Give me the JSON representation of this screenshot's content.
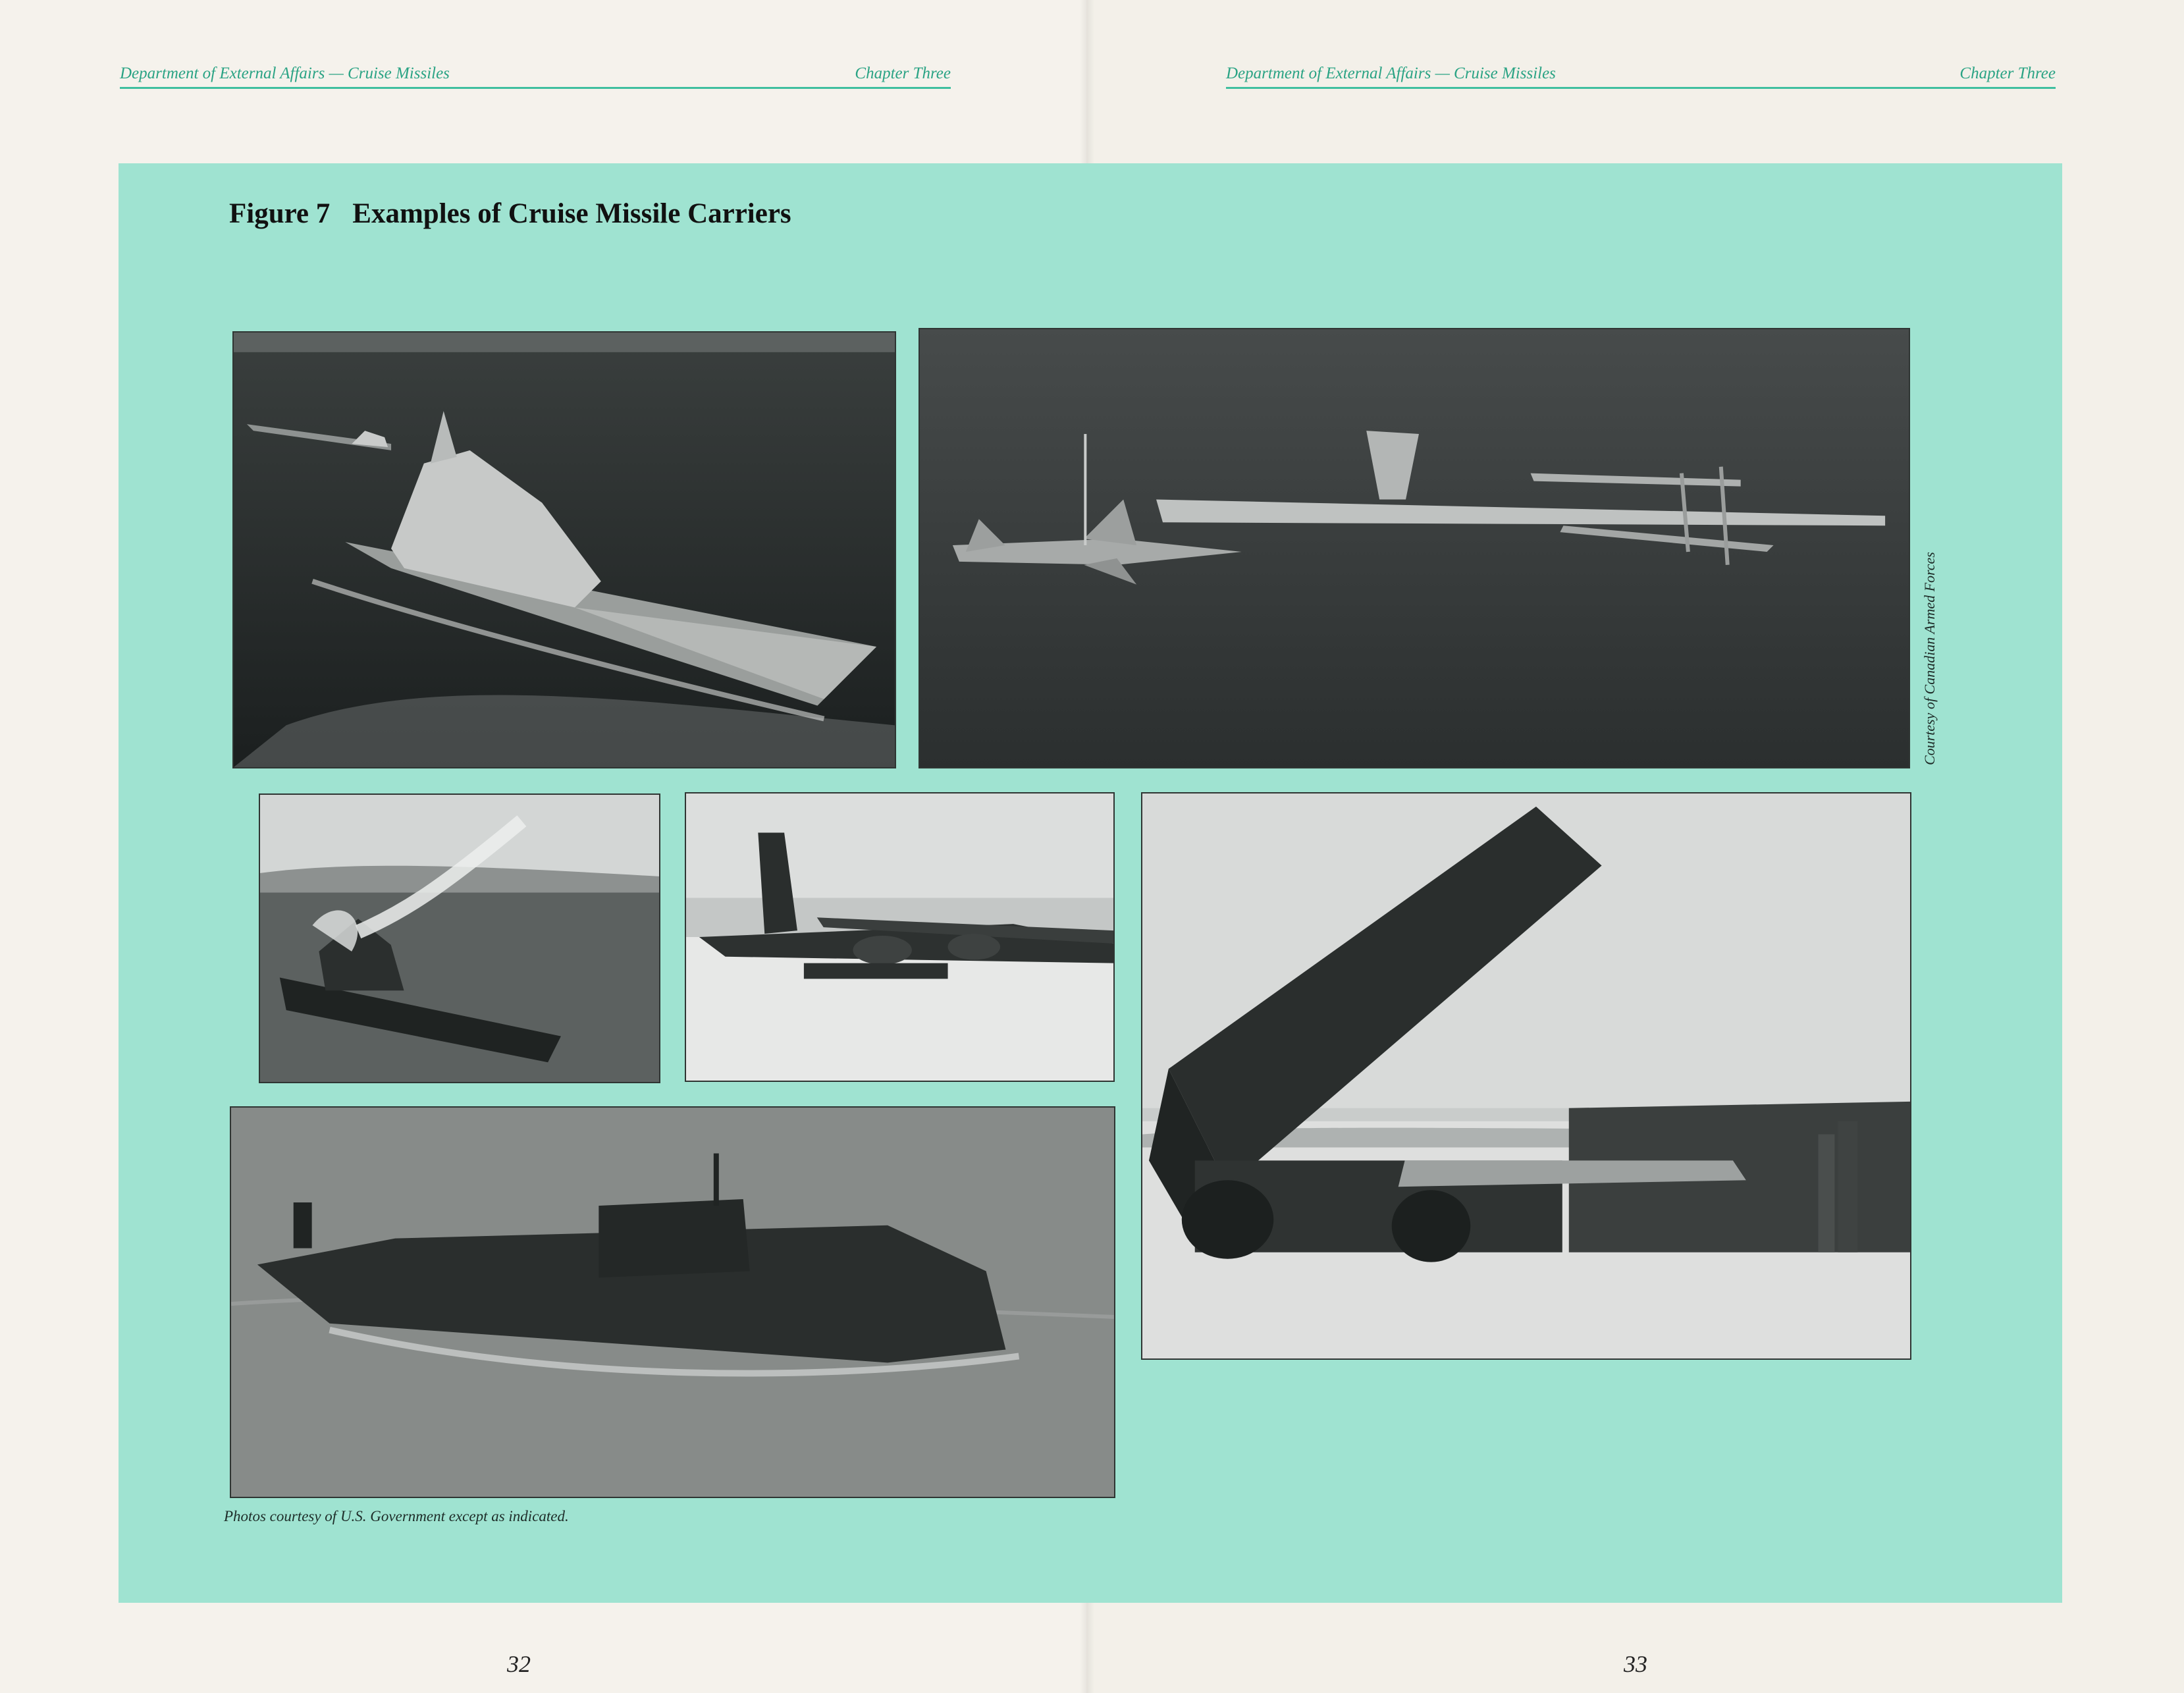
{
  "header": {
    "left_title": "Department of External Affairs — Cruise Missiles",
    "left_chapter": "Chapter Three",
    "right_title": "Department of External Affairs — Cruise Missiles",
    "right_chapter": "Chapter Three"
  },
  "figure": {
    "number": "Figure 7",
    "title": "Examples of Cruise Missile Carriers",
    "caption": "Photos courtesy of U.S. Government except as indicated.",
    "credit": "Courtesy of Canadian Armed Forces"
  },
  "photos": [
    {
      "name": "battlecruiser-photo",
      "subject": "warship at sea"
    },
    {
      "name": "aircraft-intercept-photo",
      "subject": "fighter escorting bomber"
    },
    {
      "name": "battleship-launch-photo",
      "subject": "battleship firing missile"
    },
    {
      "name": "b52-bomber-photo",
      "subject": "bomber on runway"
    },
    {
      "name": "glcm-launcher-photo",
      "subject": "ground launcher with missile"
    },
    {
      "name": "submarine-photo",
      "subject": "surfaced submarine"
    }
  ],
  "page_numbers": {
    "left": "32",
    "right": "33"
  },
  "colors": {
    "panel": "#9fe3d1",
    "accent": "#2aa384"
  }
}
